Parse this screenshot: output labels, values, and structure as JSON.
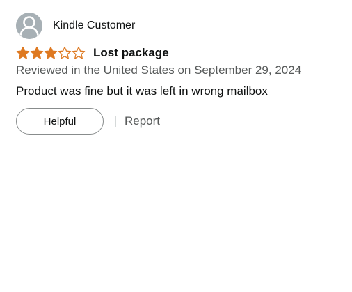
{
  "reviewer": {
    "name": "Kindle Customer",
    "avatar_icon": "person-silhouette-icon"
  },
  "review": {
    "rating": 3,
    "rating_max": 5,
    "star_color": "#de7921",
    "title": "Lost package",
    "date_line": "Reviewed in the United States on September 29, 2024",
    "body": "Product was fine but it was left in wrong mailbox"
  },
  "actions": {
    "helpful_label": "Helpful",
    "report_label": "Report"
  }
}
